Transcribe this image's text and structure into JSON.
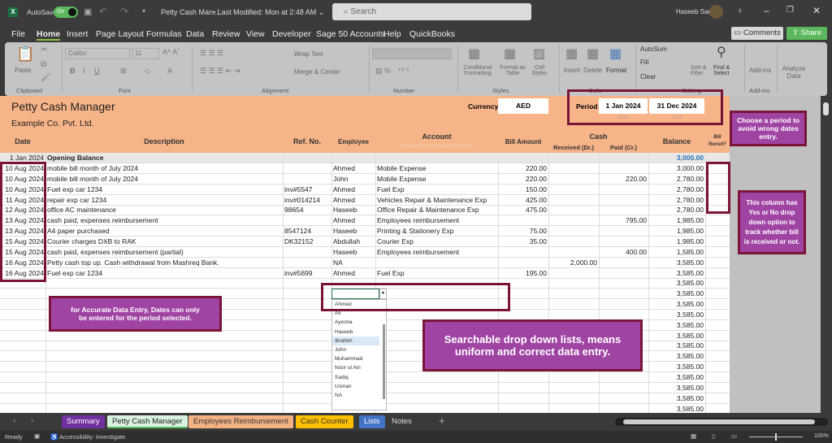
{
  "titlebar": {
    "autosave": "AutoSave",
    "toggle": "On",
    "doc_title": "Petty Cash Man...",
    "modified": "• Last Modified: Mon at 2:48 AM ⌄",
    "search_placeholder": "Search",
    "user": "Haseeb Sarfraz"
  },
  "menu": {
    "items": [
      "File",
      "Home",
      "Insert",
      "Page Layout",
      "Formulas",
      "Data",
      "Review",
      "View",
      "Developer",
      "Sage 50 Accounts",
      "Help",
      "QuickBooks"
    ],
    "comments": "Comments",
    "share": "Share"
  },
  "ribbon": {
    "paste": "Paste",
    "font_name": "Calibri",
    "font_size": "11",
    "wrap_text": "Wrap Text",
    "merge_center": "Merge & Center",
    "conditional": "Conditional Formatting",
    "format_table": "Format as Table",
    "cell_styles": "Cell Styles",
    "insert": "Insert",
    "delete": "Delete",
    "format": "Format",
    "autosum": "AutoSum",
    "fill": "Fill",
    "clear": "Clear",
    "sort": "Sort & Filter",
    "find": "Find & Select",
    "addins": "Add-ins",
    "analyze": "Analyze Data",
    "groups": {
      "clipboard": "Clipboard",
      "font": "Font",
      "alignment": "Alignment",
      "number": "Number",
      "styles": "Styles",
      "cells": "Cells",
      "editing": "Editing",
      "addins": "Add-ins"
    }
  },
  "sheet": {
    "title": "Petty Cash Manager",
    "company": "Example Co. Pvt. Ltd.",
    "currency_label": "Currency",
    "currency": "AED",
    "period_label": "Period",
    "start": "1 Jan 2024",
    "end": "31 Dec 2024",
    "start_label": "Start",
    "end_label": "End",
    "headers": {
      "date": "Date",
      "description": "Description",
      "ref": "Ref. No.",
      "employee": "Employee",
      "account": "Account",
      "account_note": "(required for summary report only)",
      "bill": "Bill Amount",
      "cash": "Cash",
      "received": "Received (Dr.)",
      "paid": "Paid (Cr.)",
      "balance": "Balance",
      "bill_recvd": "Bill Recvd?"
    },
    "opening": {
      "date": "1 Jan 2024",
      "label": "Opening Balance",
      "balance": "3,000.00"
    },
    "rows": [
      [
        "10 Aug 2024",
        "mobile bill month of July 2024",
        "",
        "Ahmed",
        "Mobile Expense",
        "220.00",
        "",
        "",
        "3,000.00"
      ],
      [
        "10 Aug 2024",
        "mobile bill month of July 2024",
        "",
        "John",
        "Mobile Expense",
        "220.00",
        "",
        "220.00",
        "2,780.00"
      ],
      [
        "10 Aug 2024",
        "Fuel exp car 1234",
        "inv#5547",
        "Ahmed",
        "Fuel Exp",
        "150.00",
        "",
        "",
        "2,780.00"
      ],
      [
        "11 Aug 2024",
        "repair exp car   1234",
        "inv#014214",
        "Ahmed",
        "Vehicles Repair & Maintenance Exp",
        "425.00",
        "",
        "",
        "2,780.00"
      ],
      [
        "12 Aug 2024",
        "office AC maintenance",
        "98654",
        "Haseeb",
        "Office Repair & Maintenance Exp",
        "475.00",
        "",
        "",
        "2,780.00"
      ],
      [
        "13 Aug 2024",
        "cash paid, expenses reimbursement",
        "",
        "Ahmed",
        "Employees reimbursement",
        "",
        "",
        "795.00",
        "1,985.00"
      ],
      [
        "13 Aug 2024",
        "A4 paper purchased",
        "8547124",
        "Haseeb",
        "Printing & Stationery Exp",
        "75.00",
        "",
        "",
        "1,985.00"
      ],
      [
        "15 Aug 2024",
        "Courier charges DXB to RAK",
        "DK32152",
        "Abdullah",
        "Courier Exp",
        "35.00",
        "",
        "",
        "1,985.00"
      ],
      [
        "15 Aug 2024",
        "cash paid, expenses reimbursement (partial)",
        "",
        "Haseeb",
        "Employees reimbursement",
        "",
        "",
        "400.00",
        "1,585.00"
      ],
      [
        "16 Aug 2024",
        "Petty cash top up. Cash withdrawal from Mashreq Bank.",
        "",
        "NA",
        "",
        "",
        "2,000.00",
        "",
        "3,585.00"
      ],
      [
        "16 Aug 2024",
        "Fuel exp car 1234",
        "inv#5699",
        "Ahmed",
        "Fuel Exp",
        "195.00",
        "",
        "",
        "3,585.00"
      ]
    ],
    "empty_balances": [
      "3,585.00",
      "3,585.00",
      "3,585.00",
      "3,585.00",
      "3,585.00",
      "3,585.00",
      "3,585.00",
      "3,585.00",
      "3,585.00",
      "3,585.00",
      "3,585.00",
      "3,585.00",
      "3,585.00"
    ],
    "dropdown_options": [
      "Ahmed",
      "Ali",
      "Ayesha",
      "Haseeb",
      "Ibrahim",
      "John",
      "Muhammad",
      "Noor ul Ain",
      "Sadiq",
      "Usman",
      "NA"
    ],
    "dropdown_highlight": "Ibrahim"
  },
  "callouts": {
    "period": "Choose a period to avoid wrong dates entry.",
    "bill": "This column has Yes or No drop down option to track whether bill is received or not.",
    "dates": "for Accurate Data Entry, Dates can only be entered for the period selected.",
    "dropdown": "Searchable drop down lists, means uniform and correct data entry."
  },
  "tabs": [
    {
      "label": "Summary",
      "bg": "#7030a0",
      "fg": "#fff"
    },
    {
      "label": "Petty Cash Manager",
      "bg": "#d9f2e0",
      "fg": "#222"
    },
    {
      "label": "Employees Reimbursement",
      "bg": "#f4b183",
      "fg": "#333"
    },
    {
      "label": "Cash  Counter",
      "bg": "#ffc000",
      "fg": "#333"
    },
    {
      "label": "Lists",
      "bg": "#4472c4",
      "fg": "#fff"
    },
    {
      "label": "Notes",
      "bg": "transparent",
      "fg": "#ddd"
    }
  ],
  "status": {
    "ready": "Ready",
    "accessibility": "Accessibility: Investigate",
    "zoom": "100%"
  },
  "colors": {
    "orange": "#f6b488",
    "purple": "#a044a4",
    "callout_border": "#7a1438",
    "balance_blue": "#2e75b6"
  }
}
